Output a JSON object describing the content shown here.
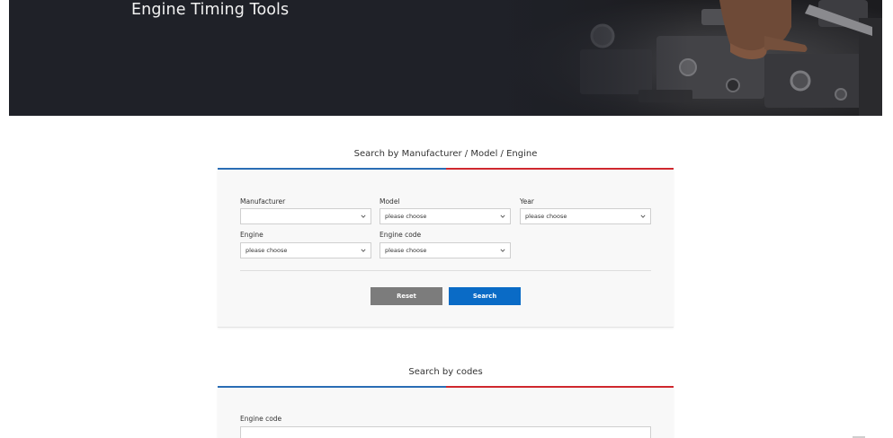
{
  "hero": {
    "title": "Engine Timing Tools"
  },
  "search_by_vehicle": {
    "title": "Search by Manufacturer / Model / Engine",
    "fields": {
      "manufacturer": {
        "label": "Manufacturer",
        "value": ""
      },
      "model": {
        "label": "Model",
        "value": "please choose"
      },
      "year": {
        "label": "Year",
        "value": "please choose"
      },
      "engine": {
        "label": "Engine",
        "value": "please choose"
      },
      "engine_code": {
        "label": "Engine code",
        "value": "please choose"
      }
    },
    "buttons": {
      "reset": "Reset",
      "search": "Search"
    }
  },
  "search_by_codes": {
    "title": "Search by codes",
    "engine_code_label": "Engine code",
    "engine_code_value": ""
  },
  "colors": {
    "hero_bg": "#1f2128",
    "accent_blue": "#2a6db5",
    "accent_red": "#d0282e",
    "search_button": "#0a6bc6",
    "reset_button": "#7c7c7c"
  },
  "icons": {
    "select_arrow": "chevron-down-icon"
  }
}
